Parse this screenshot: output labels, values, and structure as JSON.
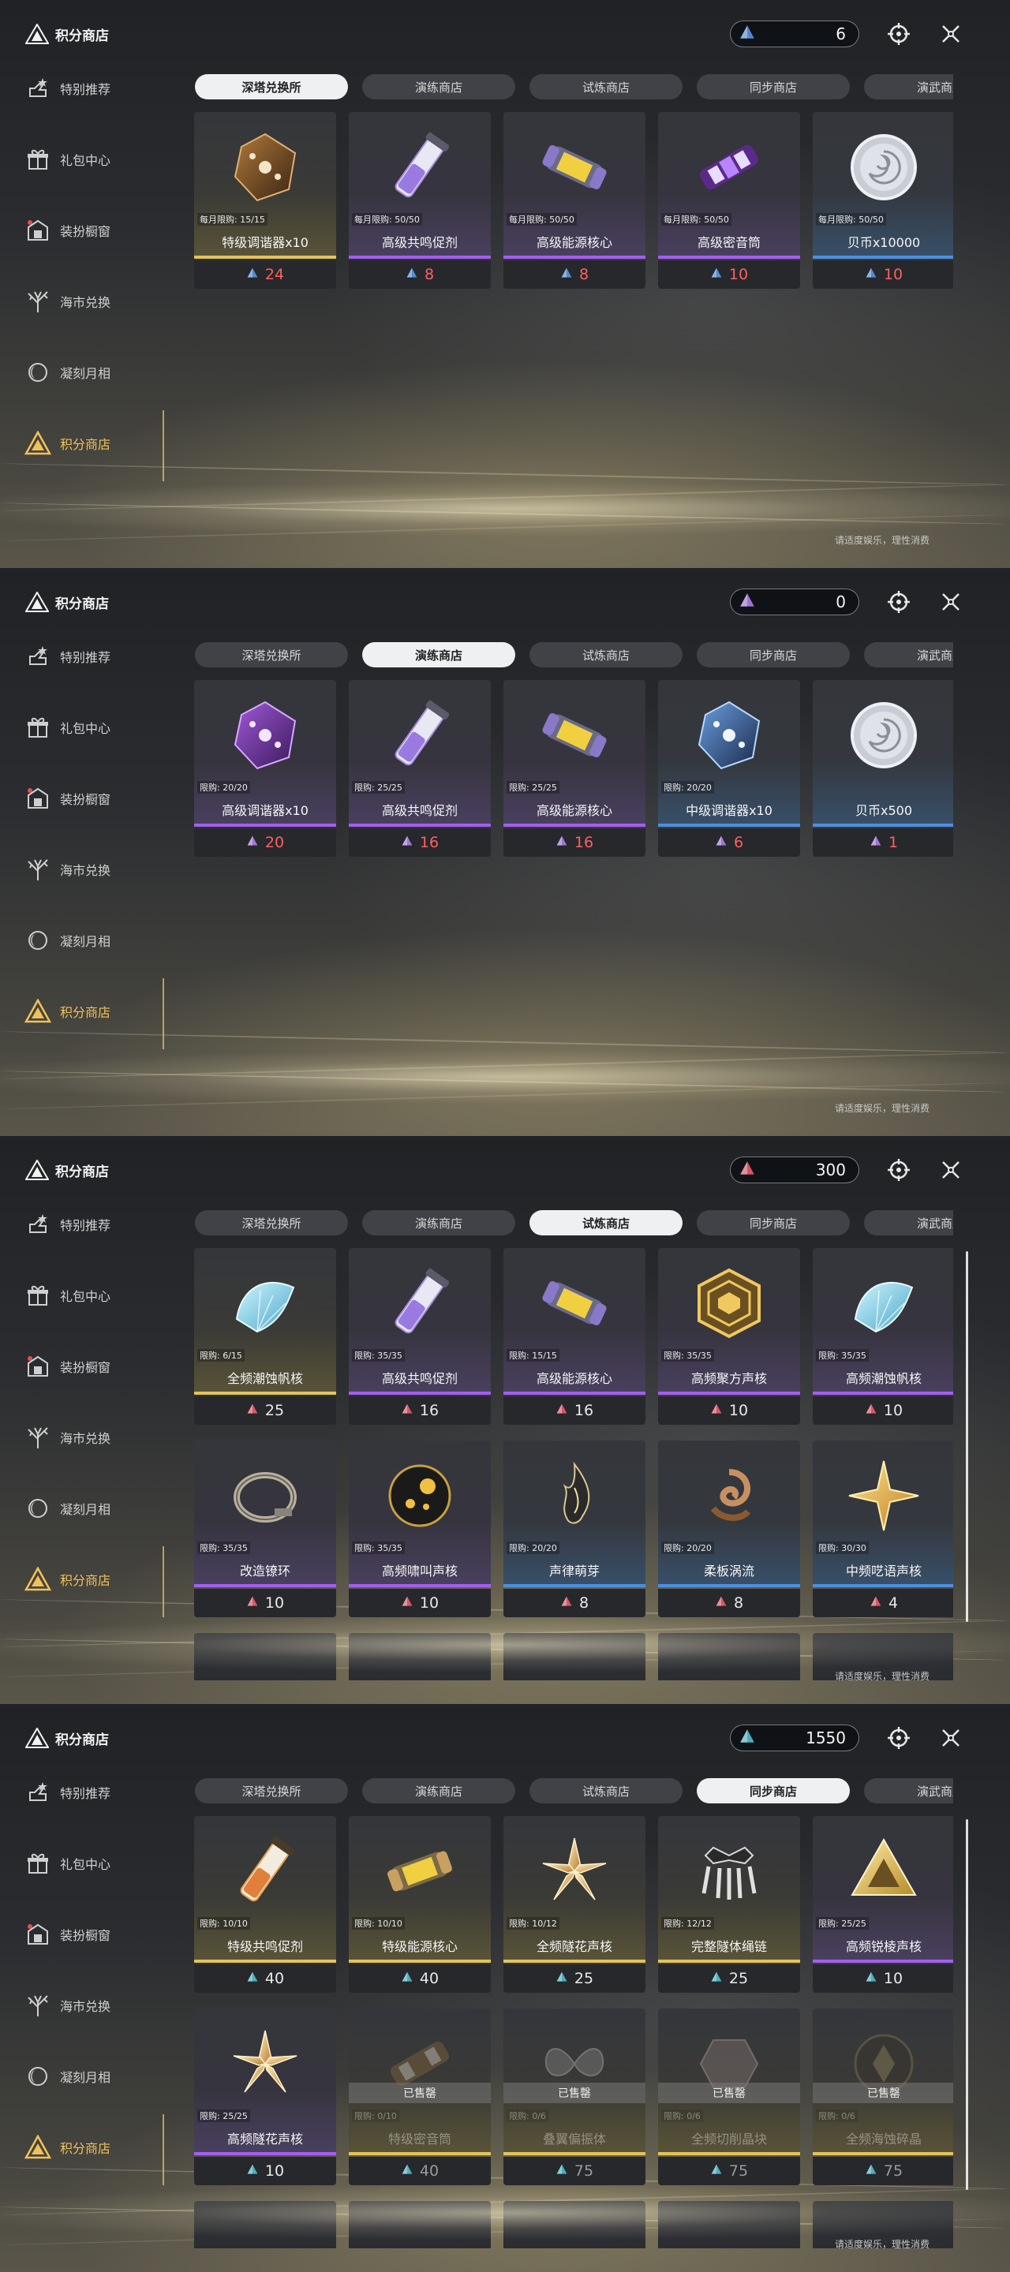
{
  "app": {
    "title": "积分商店"
  },
  "sidebar": {
    "items": [
      {
        "label": "特别推荐",
        "icon": "star-hand-icon"
      },
      {
        "label": "礼包中心",
        "icon": "gift-icon"
      },
      {
        "label": "装扮橱窗",
        "icon": "gift-shop-icon"
      },
      {
        "label": "海市兑换",
        "icon": "tree-icon"
      },
      {
        "label": "凝刻月相",
        "icon": "moon-icon"
      },
      {
        "label": "积分商店",
        "icon": "triangle-emblem-icon",
        "active": true
      }
    ]
  },
  "tabs": [
    "深塔兑换所",
    "演练商店",
    "试炼商店",
    "同步商店",
    "演武商店"
  ],
  "footer_note": "请适度娱乐，理性消费",
  "colors": {
    "gold": "#e2c45a",
    "purple": "#a35ef0",
    "blue": "#4c8fe0",
    "accent_active": "#f0c15a"
  },
  "panels": [
    {
      "active_tab": 0,
      "currency": {
        "amount": "6",
        "color": "#5b8fd8"
      },
      "cards": [
        {
          "name": "特级调谐器x10",
          "limit": "每月限购: 15/15",
          "price": "24",
          "rarity": "gold",
          "art": "tuner",
          "price_red": true
        },
        {
          "name": "高级共鸣促剂",
          "limit": "每月限购: 50/50",
          "price": "8",
          "rarity": "purple",
          "art": "vial",
          "price_red": true
        },
        {
          "name": "高级能源核心",
          "limit": "每月限购: 50/50",
          "price": "8",
          "rarity": "purple",
          "art": "capsule",
          "price_red": true
        },
        {
          "name": "高级密音筒",
          "limit": "每月限购: 50/50",
          "price": "10",
          "rarity": "purple",
          "art": "tube",
          "price_red": true
        },
        {
          "name": "贝币x10000",
          "limit": "每月限购: 50/50",
          "price": "10",
          "rarity": "blue",
          "art": "coin",
          "price_red": true
        }
      ]
    },
    {
      "active_tab": 1,
      "currency": {
        "amount": "0",
        "color": "#a77ad8"
      },
      "cards": [
        {
          "name": "高级调谐器x10",
          "limit": "限购: 20/20",
          "price": "20",
          "rarity": "purple",
          "art": "tuner-purple",
          "price_red": true
        },
        {
          "name": "高级共鸣促剂",
          "limit": "限购: 25/25",
          "price": "16",
          "rarity": "purple",
          "art": "vial",
          "price_red": true
        },
        {
          "name": "高级能源核心",
          "limit": "限购: 25/25",
          "price": "16",
          "rarity": "purple",
          "art": "capsule",
          "price_red": true
        },
        {
          "name": "中级调谐器x10",
          "limit": "限购: 20/20",
          "price": "6",
          "rarity": "blue",
          "art": "tuner-blue",
          "price_red": true
        },
        {
          "name": "贝币x500",
          "limit": "",
          "price": "1",
          "rarity": "blue",
          "art": "coin",
          "price_red": true
        }
      ]
    },
    {
      "active_tab": 2,
      "currency": {
        "amount": "300",
        "color": "#e05a6a"
      },
      "cards": [
        {
          "name": "全频潮蚀帆核",
          "limit": "限购: 6/15",
          "price": "25",
          "rarity": "gold",
          "art": "shell-blue",
          "price_red": false
        },
        {
          "name": "高级共鸣促剂",
          "limit": "限购: 35/35",
          "price": "16",
          "rarity": "purple",
          "art": "vial",
          "price_red": false
        },
        {
          "name": "高级能源核心",
          "limit": "限购: 15/15",
          "price": "16",
          "rarity": "purple",
          "art": "capsule",
          "price_red": false
        },
        {
          "name": "高频聚方声核",
          "limit": "限购: 35/35",
          "price": "10",
          "rarity": "purple",
          "art": "hexagon-gold",
          "price_red": false
        },
        {
          "name": "高频潮蚀帆核",
          "limit": "限购: 35/35",
          "price": "10",
          "rarity": "purple",
          "art": "shell-blue",
          "price_red": false
        },
        {
          "name": "改造镣环",
          "limit": "限购: 35/35",
          "price": "10",
          "rarity": "purple",
          "art": "ring",
          "price_red": false
        },
        {
          "name": "高频啸叫声核",
          "limit": "限购: 35/35",
          "price": "10",
          "rarity": "purple",
          "art": "orb",
          "price_red": false
        },
        {
          "name": "声律萌芽",
          "limit": "限购: 20/20",
          "price": "8",
          "rarity": "blue",
          "art": "flame",
          "price_red": false
        },
        {
          "name": "柔板涡流",
          "limit": "限购: 20/20",
          "price": "8",
          "rarity": "blue",
          "art": "swirl",
          "price_red": false
        },
        {
          "name": "中频呓语声核",
          "limit": "限购: 30/30",
          "price": "4",
          "rarity": "blue",
          "art": "star-gold",
          "price_red": false
        }
      ]
    },
    {
      "active_tab": 3,
      "currency": {
        "amount": "1550",
        "color": "#4fb6c6"
      },
      "cards": [
        {
          "name": "特级共鸣促剂",
          "limit": "限购: 10/10",
          "price": "40",
          "rarity": "gold",
          "art": "vial-gold",
          "price_red": false
        },
        {
          "name": "特级能源核心",
          "limit": "限购: 10/10",
          "price": "40",
          "rarity": "gold",
          "art": "capsule-gold",
          "price_red": false
        },
        {
          "name": "全频隧花声核",
          "limit": "限购: 10/12",
          "price": "25",
          "rarity": "gold",
          "art": "flower-gold",
          "price_red": false
        },
        {
          "name": "完整隧体绳链",
          "limit": "限购: 12/12",
          "price": "25",
          "rarity": "gold",
          "art": "claw",
          "price_red": false
        },
        {
          "name": "高频锐棱声核",
          "limit": "限购: 25/25",
          "price": "10",
          "rarity": "purple",
          "art": "prism-gold",
          "price_red": false
        },
        {
          "name": "高频隧花声核",
          "limit": "限购: 25/25",
          "price": "10",
          "rarity": "purple",
          "art": "flower-gold",
          "price_red": false
        },
        {
          "name": "特级密音筒",
          "limit": "限购: 0/10",
          "price": "40",
          "rarity": "gold",
          "art": "tube-gold",
          "sold": true,
          "sold_label": "已售罄"
        },
        {
          "name": "叠翼偏振体",
          "limit": "限购: 0/6",
          "price": "75",
          "rarity": "gold",
          "art": "wing",
          "sold": true,
          "sold_label": "已售罄"
        },
        {
          "name": "全频切削晶块",
          "limit": "限购: 0/6",
          "price": "75",
          "rarity": "gold",
          "art": "crystal",
          "sold": true,
          "sold_label": "已售罄"
        },
        {
          "name": "全频海蚀碎晶",
          "limit": "限购: 0/6",
          "price": "75",
          "rarity": "gold",
          "art": "shard",
          "sold": true,
          "sold_label": "已售罄"
        }
      ]
    }
  ]
}
